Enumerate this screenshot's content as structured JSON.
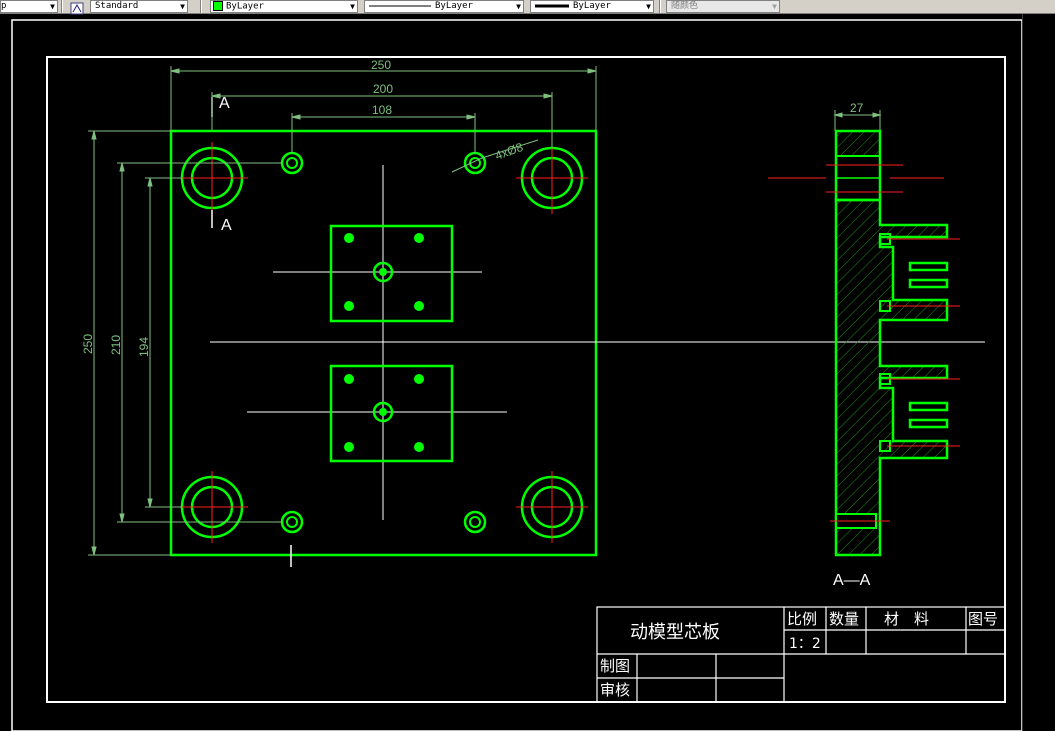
{
  "toolbar": {
    "items": [
      {
        "id": "fragment",
        "label": "p"
      },
      {
        "id": "textstyle",
        "label": "Standard"
      },
      {
        "id": "color",
        "label": "ByLayer"
      },
      {
        "id": "linetype",
        "label": "ByLayer"
      },
      {
        "id": "lineweight",
        "label": "ByLayer"
      },
      {
        "id": "plotstyle",
        "label": "随颜色"
      }
    ]
  },
  "drawing": {
    "dims": {
      "top_250": "250",
      "top_200": "200",
      "top_108": "108",
      "hole_note": "4xØ8",
      "left_250": "250",
      "left_210": "210",
      "left_194": "194",
      "side_27": "27"
    },
    "section_marks": {
      "top": "A",
      "bottom": "A",
      "view_label": "A—A"
    },
    "title_block": {
      "part_name": "动模型芯板",
      "scale_header": "比例",
      "qty_header": "数量",
      "material_header": "材　料",
      "drawing_no_header": "图号",
      "scale_value": "1：2",
      "drawn_by": "制图",
      "checked_by": "审核"
    }
  },
  "colors": {
    "geometry": "#00ff00",
    "dimension": "#7fbf7f",
    "centerline": "#ffffff",
    "hidden_red": "#ff2020",
    "background": "#000000"
  }
}
